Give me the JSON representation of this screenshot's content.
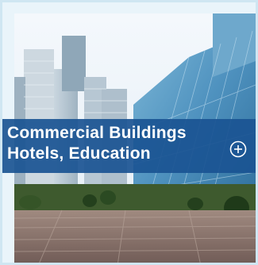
{
  "card": {
    "title_line1": "Commercial Buildings",
    "title_line2": "Hotels, Education",
    "expand_icon": "plus-circle-icon",
    "image_subject": "city-skyline-photo"
  },
  "colors": {
    "banner": "#1a5492",
    "frame": "#cfe6f2",
    "text": "#ffffff"
  }
}
